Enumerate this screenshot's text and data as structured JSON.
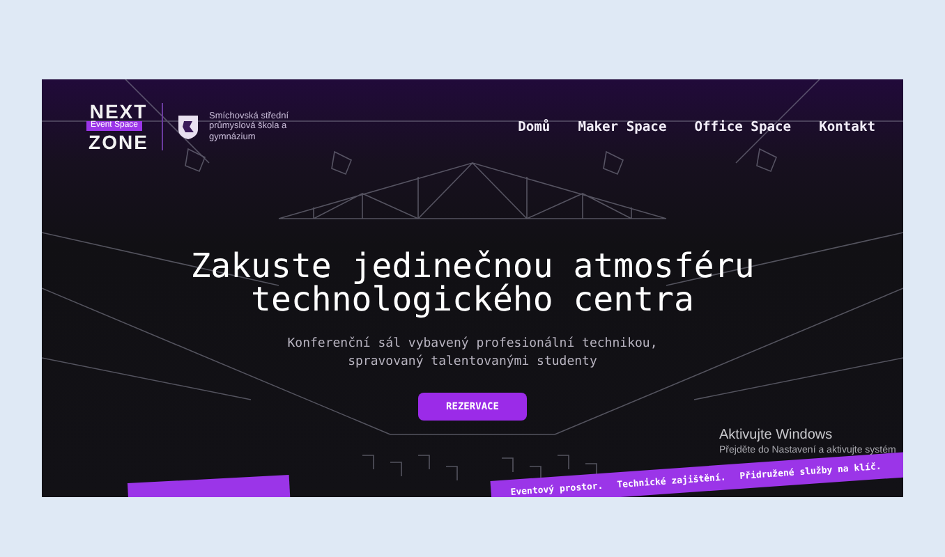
{
  "header": {
    "logo": {
      "line_1": "NEXT",
      "line_2": "ZONE",
      "badge": "Event Space"
    },
    "school": "Smíchovská střední průmyslová škola a gymnázium"
  },
  "nav": [
    {
      "label": "Domů"
    },
    {
      "label": "Maker Space"
    },
    {
      "label": "Office Space"
    },
    {
      "label": "Kontakt"
    }
  ],
  "hero": {
    "title_lines": [
      "Zakuste jedinečnou atmosféru",
      "technologického centra"
    ],
    "subtitle_lines": [
      "Konferenční sál vybavený profesionální technikou,",
      "spravovaný talentovanými studenty"
    ],
    "button": "REZERVACE"
  },
  "ticker": [
    "Eventový prostor.",
    "Technické zajištění.",
    "Přidružené služby na klíč."
  ],
  "activation_notice": {
    "title": "Aktivujte Windows",
    "text": "Přejděte do Nastavení a aktivujte systém"
  }
}
